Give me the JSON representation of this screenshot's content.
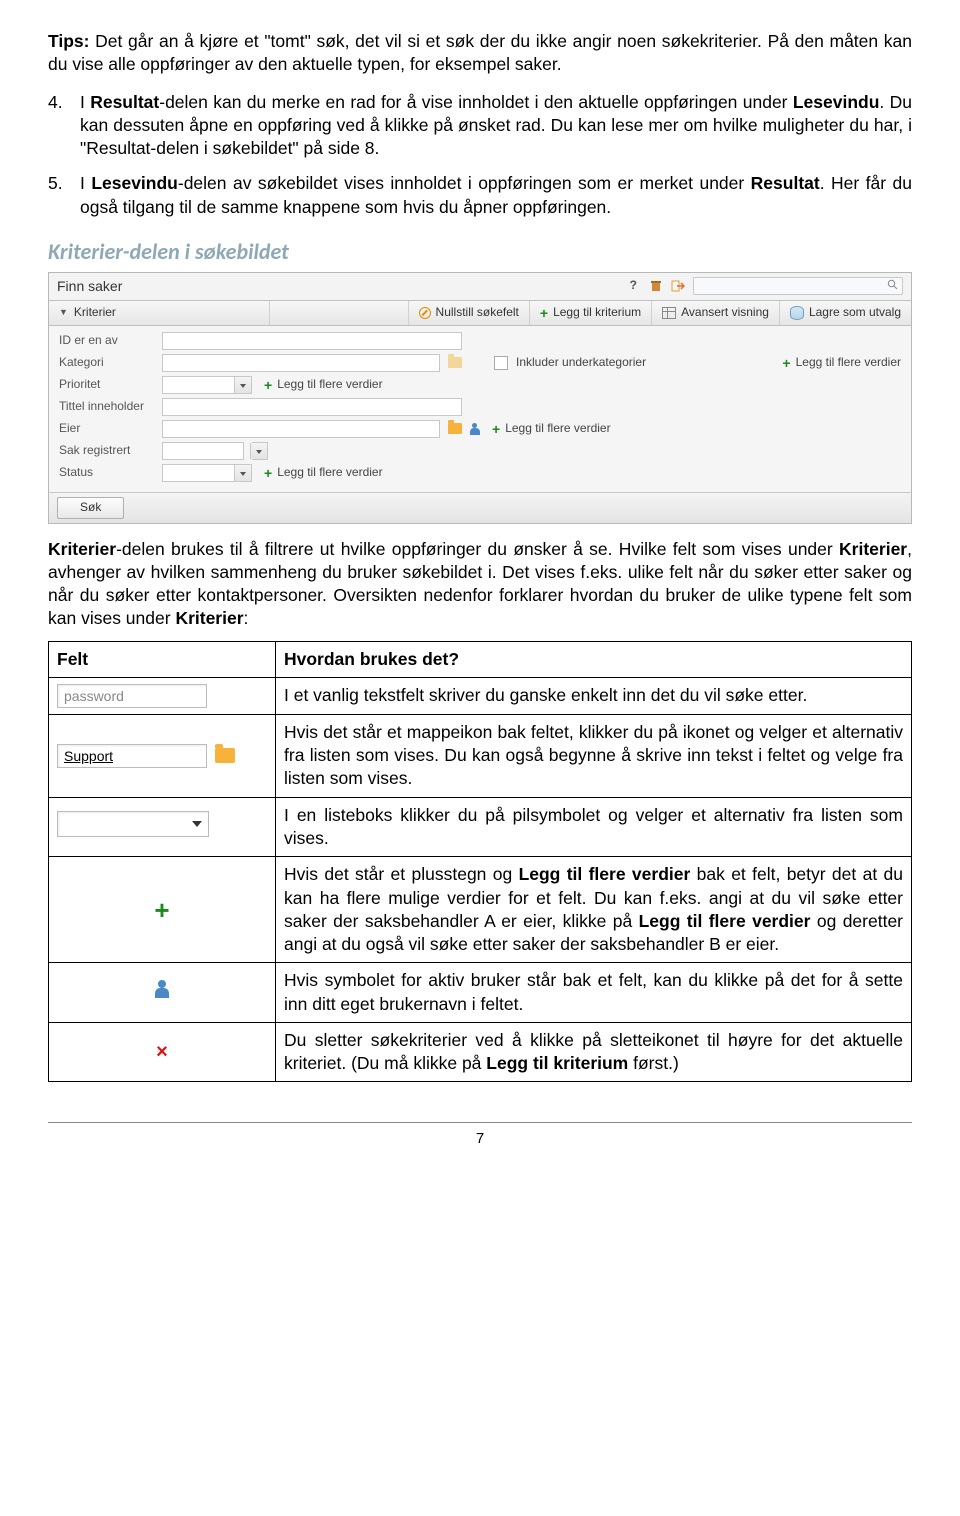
{
  "tips": {
    "label": "Tips:",
    "text": " Det går an å kjøre et \"tomt\" søk, det vil si et søk der du ikke angir noen søkekriterier. På den måten kan du vise alle oppføringer av den aktuelle typen, for eksempel saker."
  },
  "items": [
    {
      "num": "4.",
      "parts": [
        "I ",
        "Resultat",
        "-delen kan du merke en rad for å vise innholdet i den aktuelle oppføringen under ",
        "Lesevindu",
        ". Du kan dessuten åpne en oppføring ved å klikke på ønsket rad. Du kan lese mer om hvilke muligheter du har, i \"Resultat-delen i søkebildet\" på side 8."
      ]
    },
    {
      "num": "5.",
      "parts": [
        "I ",
        "Lesevindu",
        "-delen av søkebildet vises innholdet i oppføringen som er merket under ",
        "Resultat",
        ". Her får du også tilgang til de samme knappene som hvis du åpner oppføringen."
      ]
    }
  ],
  "section_heading": "Kriterier-delen i søkebildet",
  "screenshot": {
    "title": "Finn saker",
    "help": "?",
    "toolbar": {
      "kriterier": "Kriterier",
      "nullstill": "Nullstill søkefelt",
      "legg_til": "Legg til kriterium",
      "avansert": "Avansert visning",
      "lagre": "Lagre som utvalg"
    },
    "labels": {
      "id": "ID er en av",
      "kategori": "Kategori",
      "prioritet": "Prioritet",
      "tittel": "Tittel inneholder",
      "eier": "Eier",
      "sak": "Sak registrert",
      "status": "Status"
    },
    "add_more": "Legg til flere verdier",
    "inkluder": "Inkluder underkategorier",
    "sok": "Søk"
  },
  "para": {
    "parts": [
      "Kriterier",
      "-delen brukes til å filtrere ut hvilke oppføringer du ønsker å se. Hvilke felt som vises under ",
      "Kriterier",
      ", avhenger av hvilken sammenheng du bruker søkebildet i. Det vises f.eks. ulike felt når du søker etter saker og når du søker etter kontaktpersoner. Oversikten nedenfor forklarer hvordan du bruker de ulike typene felt som kan vises under ",
      "Kriterier",
      ":"
    ]
  },
  "table": {
    "head": {
      "felt": "Felt",
      "hvordan": "Hvordan brukes det?"
    },
    "rows": {
      "r1_field_ph": "password",
      "r1_desc": "I et vanlig tekstfelt skriver du ganske enkelt inn det du vil søke etter.",
      "r2_field_val": "Support",
      "r2_desc": "Hvis det står et mappeikon bak feltet, klikker du på ikonet og velger et alternativ fra listen som vises. Du kan også begynne å skrive inn tekst i feltet og velge fra listen som vises.",
      "r3_desc": "I en listeboks klikker du på pilsymbolet og velger et alternativ fra listen som vises.",
      "r4_parts": [
        "Hvis det står et plusstegn og ",
        "Legg til flere verdier",
        " bak et felt, betyr det at du kan ha flere mulige verdier for et felt. Du kan f.eks. angi at du vil søke etter saker der saksbehandler A er eier, klikke på ",
        "Legg til flere verdier",
        " og deretter angi at du også vil søke etter saker der saksbehandler B er eier."
      ],
      "r5_desc": "Hvis symbolet for aktiv bruker står bak et felt, kan du klikke på det for å sette inn ditt eget brukernavn i feltet.",
      "r6_parts": [
        "Du sletter søkekriterier ved å klikke på sletteikonet til høyre for det aktuelle kriteriet. (Du må klikke på ",
        "Legg til kriterium",
        " først.)"
      ]
    }
  },
  "page_number": "7"
}
